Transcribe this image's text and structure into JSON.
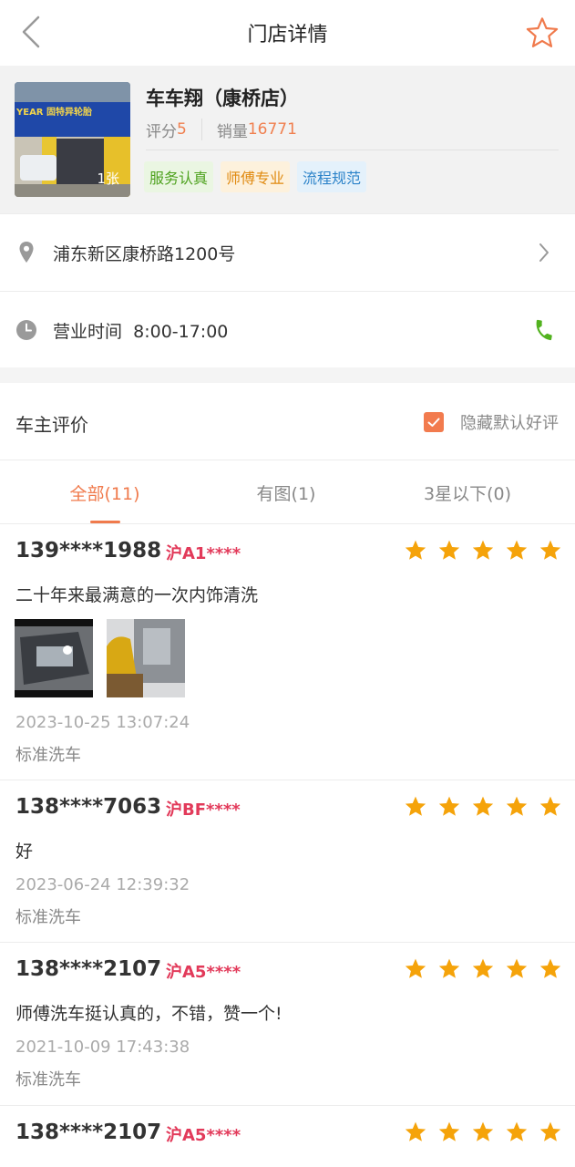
{
  "header": {
    "title": "门店详情",
    "back_icon": "chevron-left-icon",
    "favorite_icon": "star-outline-icon"
  },
  "store": {
    "name": "车车翔（康桥店）",
    "photo_sign_text": "YEAR 固特异轮胎",
    "photo_count": "1张",
    "rating_label": "评分",
    "rating_value": "5",
    "sales_label": "销量",
    "sales_value": "16771",
    "tags": [
      "服务认真",
      "师傅专业",
      "流程规范"
    ]
  },
  "address": {
    "text": "浦东新区康桥路1200号",
    "icon": "location-pin-icon"
  },
  "hours": {
    "label": "营业时间",
    "value": "8:00-17:00",
    "icon": "clock-icon",
    "action_icon": "phone-icon"
  },
  "reviews_section": {
    "title": "车主评价",
    "hide_default_label": "隐藏默认好评",
    "hide_default_checked": true,
    "tabs": [
      {
        "label": "全部(11)",
        "active": true
      },
      {
        "label": "有图(1)",
        "active": false
      },
      {
        "label": "3星以下(0)",
        "active": false
      }
    ]
  },
  "reviews": [
    {
      "phone": "139****1988",
      "plate": "沪A1****",
      "stars": 5,
      "text": "二十年来最满意的一次内饰清洗",
      "has_images": true,
      "time": "2023-10-25 13:07:24",
      "service": "标准洗车"
    },
    {
      "phone": "138****7063",
      "plate": "沪BF****",
      "stars": 5,
      "text": "好",
      "has_images": false,
      "time": "2023-06-24 12:39:32",
      "service": "标准洗车"
    },
    {
      "phone": "138****2107",
      "plate": "沪A5****",
      "stars": 5,
      "text": "师傅洗车挺认真的，不错，赞一个!",
      "has_images": false,
      "time": "2021-10-09 17:43:38",
      "service": "标准洗车"
    },
    {
      "phone": "138****2107",
      "plate": "沪A5****",
      "stars": 5
    }
  ],
  "colors": {
    "accent": "#f07a4c",
    "star": "#f5a30a",
    "plate": "#e23a5a",
    "phone_icon": "#52b21f"
  }
}
